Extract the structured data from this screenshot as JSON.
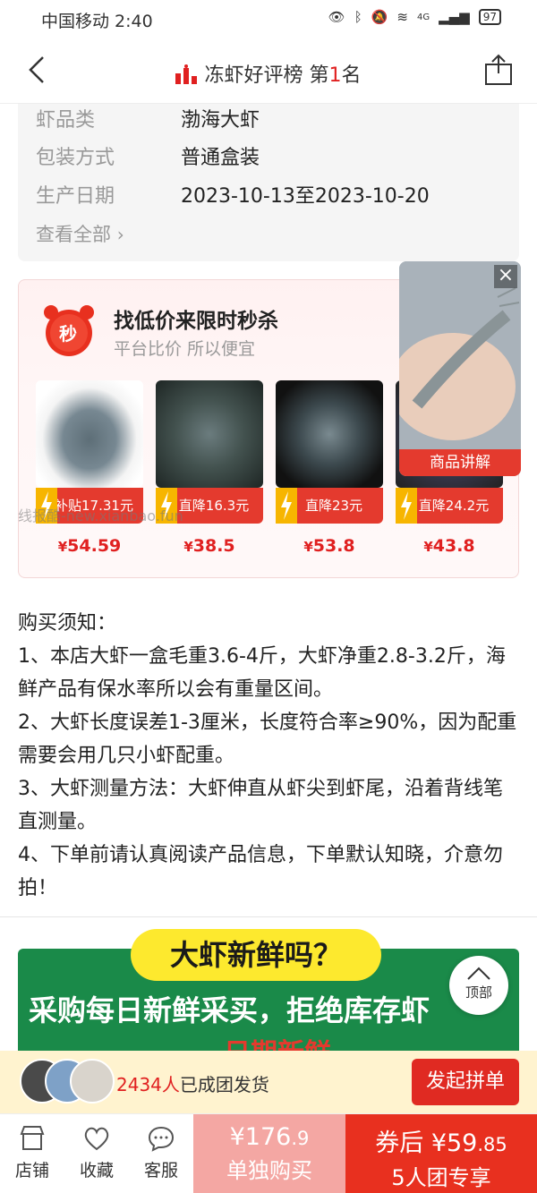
{
  "status_bar": {
    "carrier_time": "中国移动 2:40",
    "battery": "97",
    "network": "4G"
  },
  "nav": {
    "title_prefix": "冻虾好评榜 第",
    "rank": "1",
    "title_suffix": "名"
  },
  "specs": {
    "rows": [
      {
        "key": "虾品类",
        "value": "渤海大虾"
      },
      {
        "key": "包装方式",
        "value": "普通盒装"
      },
      {
        "key": "生产日期",
        "value": "2023-10-13至2023-10-20"
      }
    ],
    "more": "查看全部"
  },
  "flash_sale": {
    "badge": "秒",
    "title": "找低价来限时秒杀",
    "subtitle": "平台比价 所以便宜",
    "products": [
      {
        "tag": "补贴17.31元",
        "currency": "¥",
        "price": "54.59"
      },
      {
        "tag": "直降16.3元",
        "currency": "¥",
        "price": "38.5"
      },
      {
        "tag": "直降23元",
        "currency": "¥",
        "price": "53.8"
      },
      {
        "tag": "直降24.2元",
        "currency": "¥",
        "price": "43.8"
      }
    ]
  },
  "watermark": "线报酷-new.xianbao.fun",
  "video": {
    "label": "商品讲解",
    "close": "×"
  },
  "notes": {
    "heading": "购买须知：",
    "items": [
      "1、本店大虾一盒毛重3.6-4斤，大虾净重2.8-3.2斤，海鲜产品有保水率所以会有重量区间。",
      "2、大虾长度误差1-3厘米，长度符合率≥90%，因为配重需要会用几只小虾配重。",
      "3、大虾测量方法：大虾伸直从虾尖到虾尾，沿着背线笔直测量。",
      "4、下单前请认真阅读产品信息，下单默认知晓，介意勿拍！"
    ]
  },
  "banner": {
    "headline": "大虾新鲜吗？",
    "line1": "采购每日新鲜采买，拒绝库存虾",
    "line2": "日期新鲜"
  },
  "back_to_top": "顶部",
  "group": {
    "count": "2434人",
    "text": "已成团发货",
    "button": "发起拼单"
  },
  "bottom": {
    "tools": [
      "店铺",
      "收藏",
      "客服"
    ],
    "solo": {
      "price_main": "¥176",
      "price_dec": ".9",
      "label": "单独购买"
    },
    "group_buy": {
      "price_prefix": "券后 ¥59",
      "price_dec": ".85",
      "label": "5人团专享"
    }
  },
  "colors": {
    "accent": "#e02020",
    "banner_green": "#1a8a49",
    "banner_yellow": "#fde92e",
    "group_bar_bg": "#fff3cf"
  }
}
